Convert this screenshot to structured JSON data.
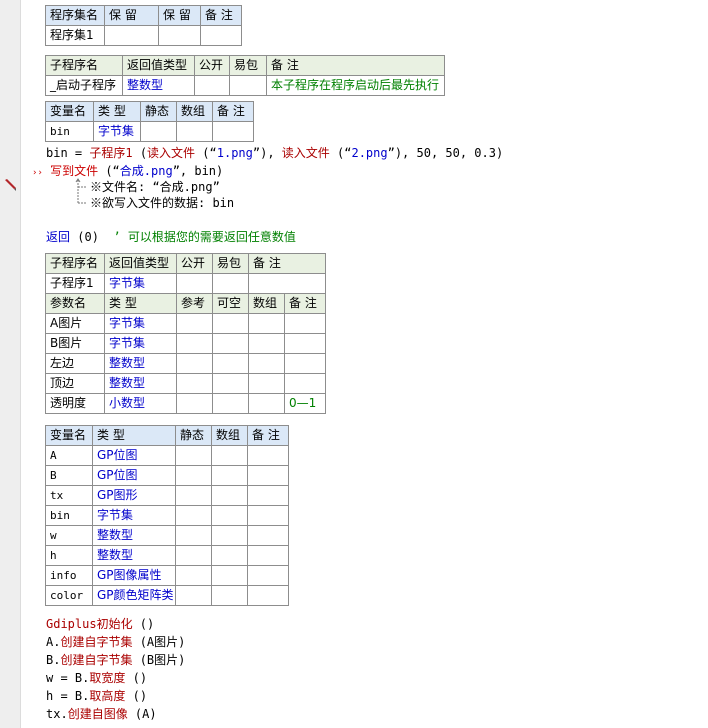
{
  "program_set_table": {
    "headers": [
      "程序集名",
      "保 留",
      "保 留",
      "备 注"
    ],
    "row": [
      "程序集1",
      "",
      "",
      ""
    ]
  },
  "sub_start_table": {
    "headers": [
      "子程序名",
      "返回值类型",
      "公开",
      "易包",
      "备 注"
    ],
    "row": [
      "_启动子程序",
      "整数型",
      "",
      "",
      "本子程序在程序启动后最先执行"
    ]
  },
  "local_var_table": {
    "headers": [
      "变量名",
      "类 型",
      "静态",
      "数组",
      "备 注"
    ],
    "row": [
      "bin",
      "字节集",
      "",
      "",
      ""
    ]
  },
  "code_block_1": {
    "line1": {
      "pre": "bin = ",
      "fn": "子程序1",
      "mid": " (",
      "fn2": "读入文件",
      "a": " (“",
      "s1": "1.png",
      "b": "”), ",
      "fn3": "读入文件",
      "c": " (“",
      "s2": "2.png",
      "d": "”), 50, 50, 0.3)"
    },
    "line2": {
      "marker": "››",
      "fn": "写到文件",
      "a": " (“",
      "s": "合成.png",
      "b": "”, bin)"
    },
    "param_hint_1": "※文件名: “合成.png”",
    "param_hint_2": "※欲写入文件的数据: bin",
    "line3": {
      "kw": "返回",
      "args": " (0)  ",
      "cm": "’ 可以根据您的需要返回任意数值"
    }
  },
  "sub1_table": {
    "headers": [
      "子程序名",
      "返回值类型",
      "公开",
      "易包",
      "备 注"
    ],
    "row": [
      "子程序1",
      "字节集",
      "",
      "",
      ""
    ],
    "param_headers": [
      "参数名",
      "类 型",
      "参考",
      "可空",
      "数组",
      "备 注"
    ],
    "params": [
      {
        "name": "A图片",
        "type": "字节集",
        "note": ""
      },
      {
        "name": "B图片",
        "type": "字节集",
        "note": ""
      },
      {
        "name": "左边",
        "type": "整数型",
        "note": ""
      },
      {
        "name": "顶边",
        "type": "整数型",
        "note": ""
      },
      {
        "name": "透明度",
        "type": "小数型",
        "note": "0—1"
      }
    ]
  },
  "sub1_vars": {
    "headers": [
      "变量名",
      "类 型",
      "静态",
      "数组",
      "备 注"
    ],
    "rows": [
      {
        "name": "A",
        "type": "GP位图"
      },
      {
        "name": "B",
        "type": "GP位图"
      },
      {
        "name": "tx",
        "type": "GP图形"
      },
      {
        "name": "bin",
        "type": "字节集"
      },
      {
        "name": "w",
        "type": "整数型"
      },
      {
        "name": "h",
        "type": "整数型"
      },
      {
        "name": "info",
        "type": "GP图像属性"
      },
      {
        "name": "color",
        "type": "GP颜色矩阵类"
      }
    ]
  },
  "code_block_2": [
    {
      "pre": "",
      "fn": "Gdiplus初始化",
      "post": " ()"
    },
    {
      "pre": "A.",
      "fn": "创建自字节集",
      "post": " (A图片)"
    },
    {
      "pre": "B.",
      "fn": "创建自字节集",
      "post": " (B图片)"
    },
    {
      "pre": "w = B.",
      "fn": "取宽度",
      "post": " ()"
    },
    {
      "pre": "h = B.",
      "fn": "取高度",
      "post": " ()"
    },
    {
      "pre": "tx.",
      "fn": "创建自图像",
      "post": " (A)"
    }
  ]
}
